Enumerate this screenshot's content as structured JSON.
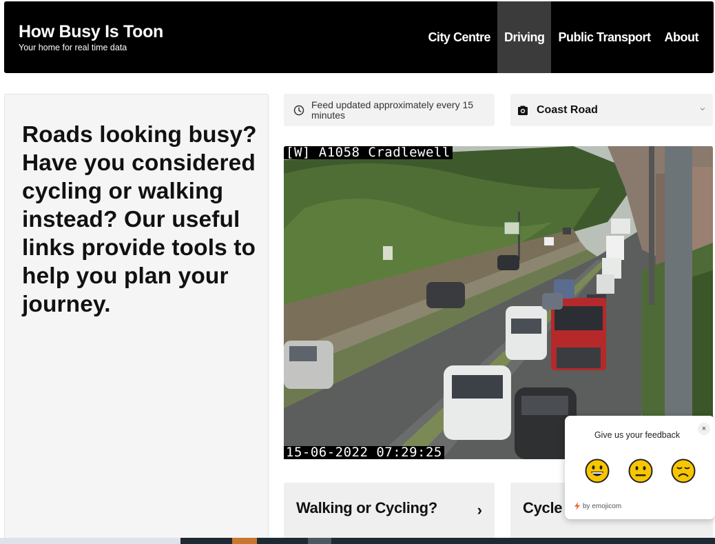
{
  "header": {
    "title": "How Busy Is Toon",
    "subtitle": "Your home for real time data",
    "nav": [
      {
        "label": "City Centre",
        "active": false
      },
      {
        "label": "Driving",
        "active": true
      },
      {
        "label": "Public Transport",
        "active": false
      },
      {
        "label": "About",
        "active": false
      }
    ]
  },
  "info": {
    "text": "Roads looking busy? Have you considered cycling or walking instead? Our useful links provide tools to help you plan your journey."
  },
  "feed": {
    "notice": "Feed updated approximately every 15 minutes",
    "icon": "clock-icon"
  },
  "camera": {
    "selected": "Coast Road",
    "icon": "camera-icon",
    "location_overlay": "[W] A1058 Cradlewell",
    "timestamp_overlay": "15-06-2022 07:29:25"
  },
  "links": [
    {
      "label": "Walking or Cycling?",
      "arrow": "›"
    },
    {
      "label": "Cycle",
      "arrow": ""
    }
  ],
  "feedback": {
    "title": "Give us your feedback",
    "close": "×",
    "options": [
      "happy",
      "neutral",
      "sad"
    ],
    "brand": "by emojicom"
  },
  "colors": {
    "header_bg": "#000000",
    "nav_active_bg": "#3b3b3b",
    "card_bg": "#f5f5f5",
    "emoji_yellow": "#f7c600"
  }
}
